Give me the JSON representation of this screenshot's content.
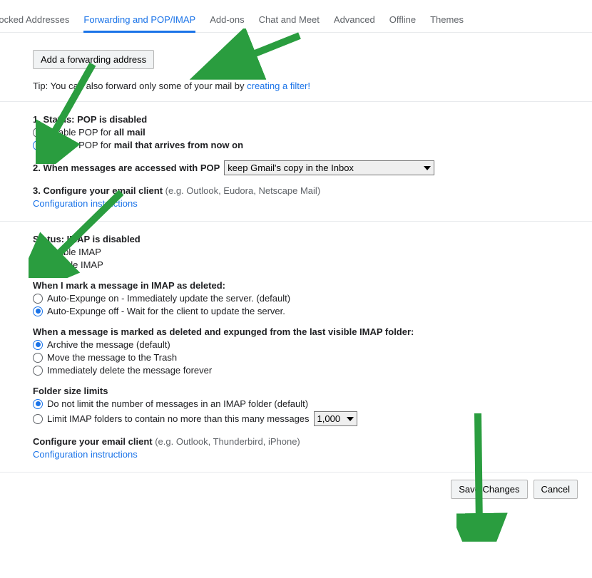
{
  "tabs": {
    "blocked": "d Blocked Addresses",
    "forwarding": "Forwarding and POP/IMAP",
    "addons": "Add-ons",
    "chat": "Chat and Meet",
    "advanced": "Advanced",
    "offline": "Offline",
    "themes": "Themes"
  },
  "forwarding": {
    "add_button": "Add a forwarding address",
    "tip_prefix": "Tip: You can also forward only some of your mail by ",
    "tip_link": "creating a filter!"
  },
  "pop": {
    "status_label": "1. Status: ",
    "status_value": "POP is disabled",
    "opt1_prefix": "Enable POP for ",
    "opt1_bold": "all mail",
    "opt2_prefix": "Enable POP for ",
    "opt2_bold": "mail that arrives from now on",
    "access_label": "2. When messages are accessed with POP",
    "access_select": "keep Gmail's copy in the Inbox",
    "config_label": "3. Configure your email client ",
    "config_eg": "(e.g. Outlook, Eudora, Netscape Mail)",
    "config_link": "Configuration instructions"
  },
  "imap": {
    "status_label": "Status: ",
    "status_value": "IMAP is disabled",
    "enable": "Enable IMAP",
    "disable": "Disable IMAP",
    "deleted_label": "When I mark a message in IMAP as deleted:",
    "expunge_on": "Auto-Expunge on - Immediately update the server. (default)",
    "expunge_off": "Auto-Expunge off - Wait for the client to update the server.",
    "expunged_label": "When a message is marked as deleted and expunged from the last visible IMAP folder:",
    "exp1": "Archive the message (default)",
    "exp2": "Move the message to the Trash",
    "exp3": "Immediately delete the message forever",
    "folder_label": "Folder size limits",
    "folder1": "Do not limit the number of messages in an IMAP folder (default)",
    "folder2": "Limit IMAP folders to contain no more than this many messages",
    "folder_select": "1,000",
    "config_label": "Configure your email client ",
    "config_eg": "(e.g. Outlook, Thunderbird, iPhone)",
    "config_link": "Configuration instructions"
  },
  "footer": {
    "save": "Save Changes",
    "cancel": "Cancel"
  }
}
